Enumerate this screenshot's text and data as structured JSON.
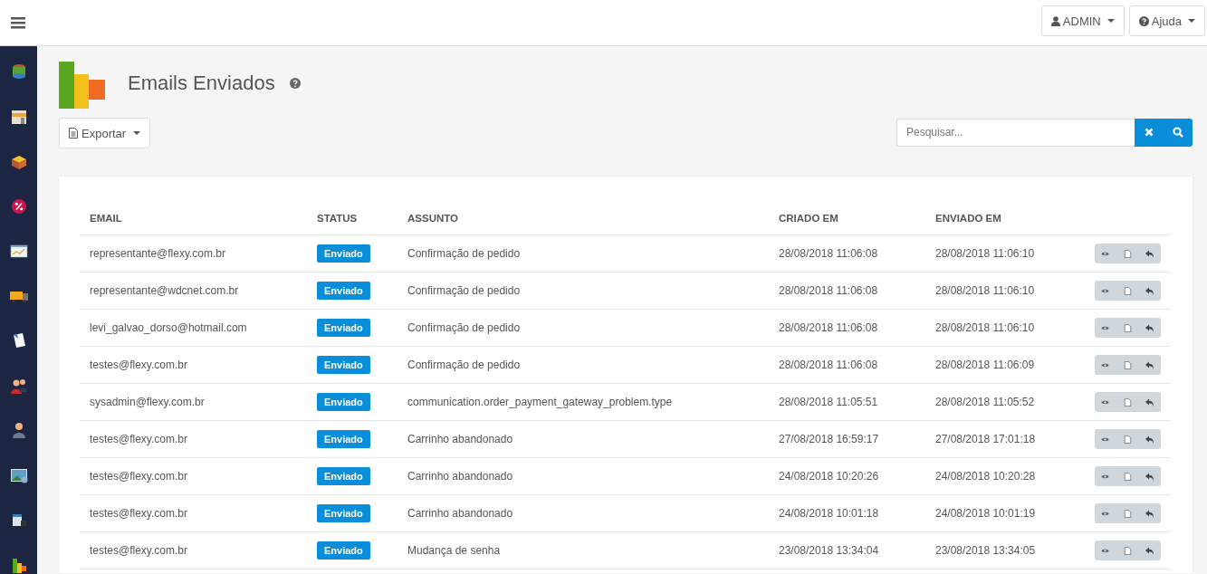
{
  "topbar": {
    "user_menu": "ADMIN",
    "help_menu": "Ajuda"
  },
  "sidebar": {
    "items": [
      {
        "kind": "database"
      },
      {
        "kind": "store"
      },
      {
        "kind": "box"
      },
      {
        "kind": "percent"
      },
      {
        "kind": "chart-window"
      },
      {
        "kind": "truck"
      },
      {
        "kind": "note"
      },
      {
        "kind": "people"
      },
      {
        "kind": "person"
      },
      {
        "kind": "picture"
      },
      {
        "kind": "bucket"
      },
      {
        "kind": "bars"
      }
    ]
  },
  "page": {
    "title": "Emails Enviados",
    "export_button": "Exportar",
    "search": {
      "placeholder": "Pesquisar..."
    }
  },
  "table": {
    "columns": [
      "EMAIL",
      "STATUS",
      "ASSUNTO",
      "CRIADO EM",
      "ENVIADO EM"
    ],
    "rows": [
      {
        "email": "representante@flexy.com.br",
        "status": "Enviado",
        "subject": "Confirmação de pedido",
        "created": "28/08/2018 11:06:08",
        "sent": "28/08/2018 11:06:10"
      },
      {
        "email": "representante@wdcnet.com.br",
        "status": "Enviado",
        "subject": "Confirmação de pedido",
        "created": "28/08/2018 11:06:08",
        "sent": "28/08/2018 11:06:10"
      },
      {
        "email": "levi_galvao_dorso@hotmail.com",
        "status": "Enviado",
        "subject": "Confirmação de pedido",
        "created": "28/08/2018 11:06:08",
        "sent": "28/08/2018 11:06:10"
      },
      {
        "email": "testes@flexy.com.br",
        "status": "Enviado",
        "subject": "Confirmação de pedido",
        "created": "28/08/2018 11:06:08",
        "sent": "28/08/2018 11:06:09"
      },
      {
        "email": "sysadmin@flexy.com.br",
        "status": "Enviado",
        "subject": "communication.order_payment_gateway_problem.type",
        "created": "28/08/2018 11:05:51",
        "sent": "28/08/2018 11:05:52"
      },
      {
        "email": "testes@flexy.com.br",
        "status": "Enviado",
        "subject": "Carrinho abandonado",
        "created": "27/08/2018 16:59:17",
        "sent": "27/08/2018 17:01:18"
      },
      {
        "email": "testes@flexy.com.br",
        "status": "Enviado",
        "subject": "Carrinho abandonado",
        "created": "24/08/2018 10:20:26",
        "sent": "24/08/2018 10:20:28"
      },
      {
        "email": "testes@flexy.com.br",
        "status": "Enviado",
        "subject": "Carrinho abandonado",
        "created": "24/08/2018 10:01:18",
        "sent": "24/08/2018 10:01:19"
      },
      {
        "email": "testes@flexy.com.br",
        "status": "Enviado",
        "subject": "Mudança de senha",
        "created": "23/08/2018 13:34:04",
        "sent": "23/08/2018 13:34:05"
      }
    ]
  }
}
